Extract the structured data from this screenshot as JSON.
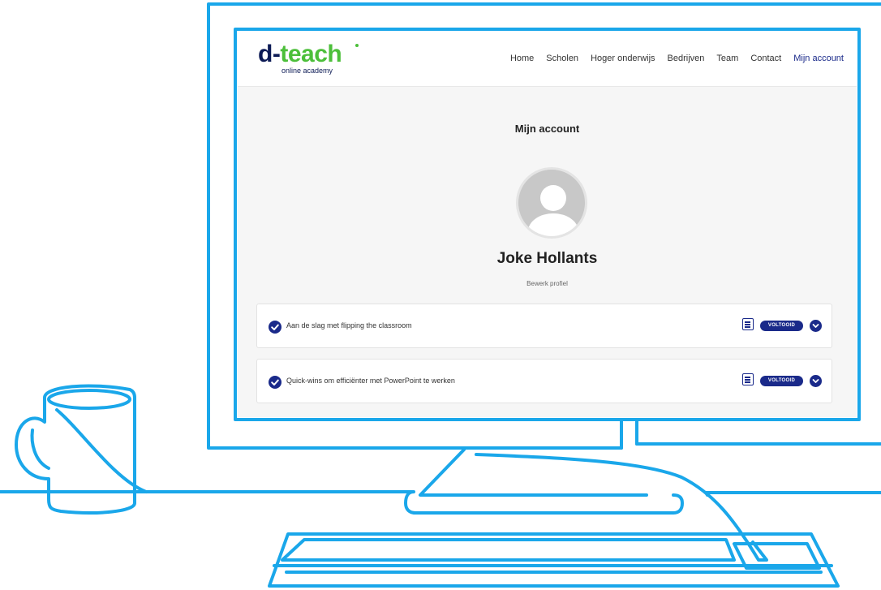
{
  "brand": {
    "logo_part1": "d-",
    "logo_part2": "teach",
    "tagline": "online academy"
  },
  "nav": {
    "items": [
      "Home",
      "Scholen",
      "Hoger onderwijs",
      "Bedrijven",
      "Team",
      "Contact",
      "Mijn account"
    ],
    "active": "Mijn account"
  },
  "page": {
    "title": "Mijn account"
  },
  "profile": {
    "name": "Joke Hollants",
    "edit_label": "Bewerk profiel"
  },
  "courses": [
    {
      "title": "Aan de slag met flipping the classroom",
      "status": "VOLTOOID",
      "status_icon": "check-circle-icon",
      "doc_icon": "document-icon",
      "expand_icon": "chevron-down-icon"
    },
    {
      "title": "Quick-wins om efficiënter met PowerPoint te werken",
      "status": "VOLTOOID",
      "status_icon": "check-circle-icon",
      "doc_icon": "document-icon",
      "expand_icon": "chevron-down-icon"
    }
  ],
  "colors": {
    "outline": "#1aa7ea",
    "brand_navy": "#1a2a8a",
    "brand_green": "#4cbf3a",
    "screen_background": "#f6f6f6"
  }
}
